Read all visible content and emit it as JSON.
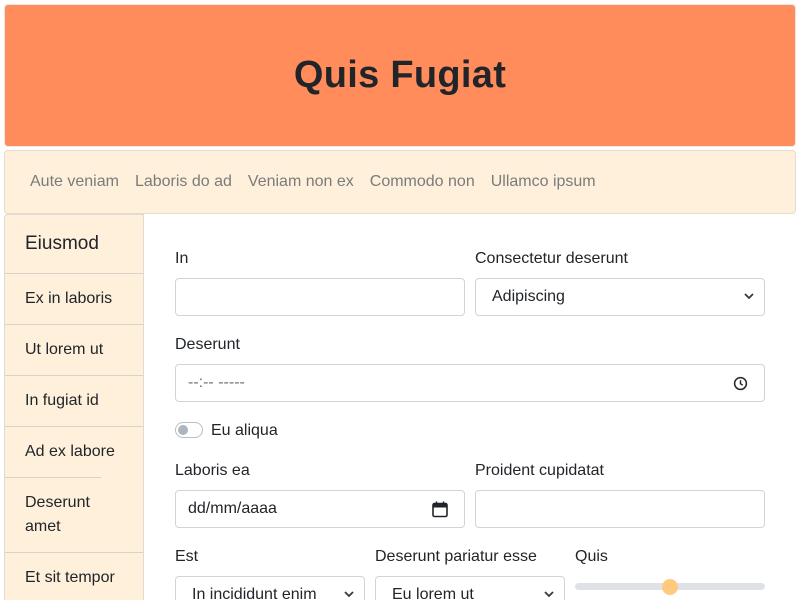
{
  "header": {
    "title": "Quis Fugiat"
  },
  "nav": {
    "links": [
      "Aute veniam",
      "Laboris do ad",
      "Veniam non ex",
      "Commodo non",
      "Ullamco ipsum"
    ]
  },
  "sidebar": {
    "title": "Eiusmod",
    "items": [
      {
        "label": "Ex in laboris"
      },
      {
        "label": "Ut lorem ut"
      },
      {
        "label": "In fugiat id"
      },
      {
        "label": "Ad ex labore"
      },
      {
        "label": "Deserunt amet"
      },
      {
        "label": "Et sit tempor"
      }
    ]
  },
  "form": {
    "in_label": "In",
    "in_value": "",
    "consectetur_label": "Consectetur deserunt",
    "consectetur_value": "Adipiscing",
    "deserunt_label": "Deserunt",
    "deserunt_time_value": "--:-- -----",
    "switch_label": "Eu aliqua",
    "switch_on": false,
    "laboris_label": "Laboris ea",
    "laboris_date_value": "dd/mm/aaaa",
    "proident_label": "Proident cupidatat",
    "proident_value": "",
    "est_label": "Est",
    "est_value": "In incididunt enim",
    "deserunt_pariatur_label": "Deserunt pariatur esse",
    "deserunt_pariatur_value": "Eu lorem ut",
    "quis_label": "Quis",
    "quis_range_fraction": 0.5
  },
  "colors": {
    "header_bg": "#ff8c5a",
    "panel_bg": "#fff0db",
    "range_thumb": "#ffc980"
  }
}
